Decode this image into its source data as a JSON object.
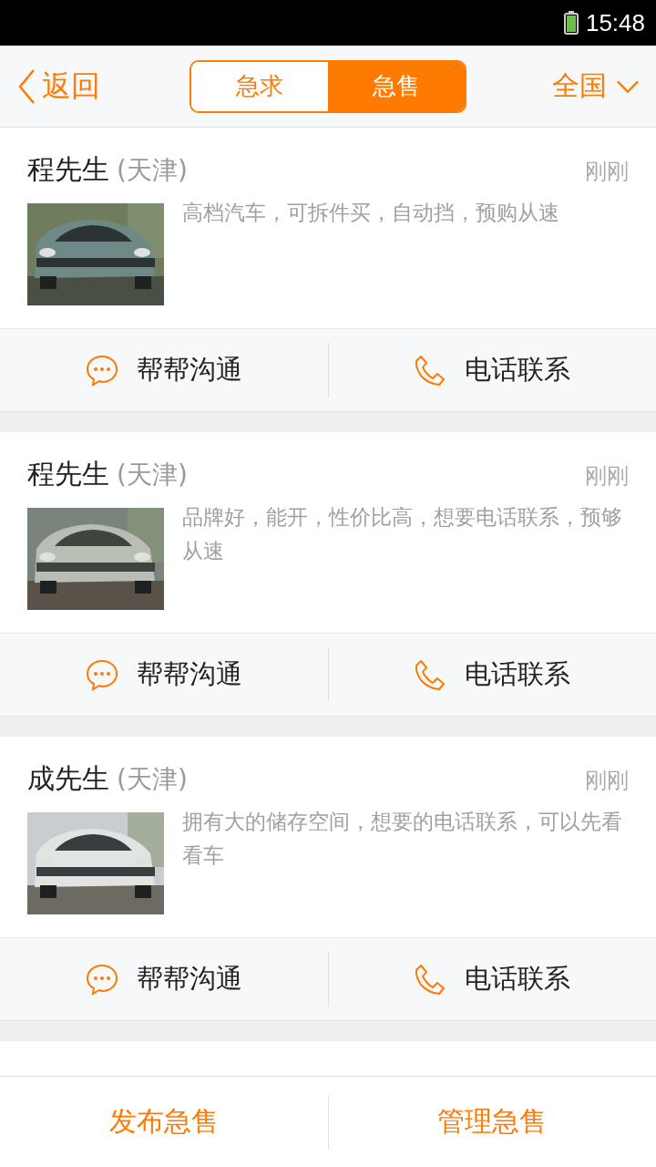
{
  "status_bar": {
    "time": "15:48"
  },
  "header": {
    "back": "返回",
    "tabs": [
      {
        "label": "急求",
        "selected": false
      },
      {
        "label": "急售",
        "selected": true
      }
    ],
    "region": "全国"
  },
  "listings": [
    {
      "name": "程先生",
      "city": "(天津)",
      "time": "刚刚",
      "description": "高档汽车，可拆件买，自动挡，预购从速",
      "photo": {
        "kind": "picture"
      },
      "actions": [
        "帮帮沟通",
        "电话联系"
      ]
    },
    {
      "name": "程先生",
      "city": "(天津)",
      "time": "刚刚",
      "description": "品牌好，能开，性价比高，想要电话联系，预够从速",
      "photo": {
        "kind": "picture"
      },
      "actions": [
        "帮帮沟通",
        "电话联系"
      ]
    },
    {
      "name": "成先生",
      "city": "(天津)",
      "time": "刚刚",
      "description": "拥有大的储存空间，想要的电话联系，可以先看看车",
      "photo": {
        "kind": "picture"
      },
      "actions": [
        "帮帮沟通",
        "电话联系"
      ]
    }
  ],
  "bottom_bar": [
    "发布急售",
    "管理急售"
  ]
}
